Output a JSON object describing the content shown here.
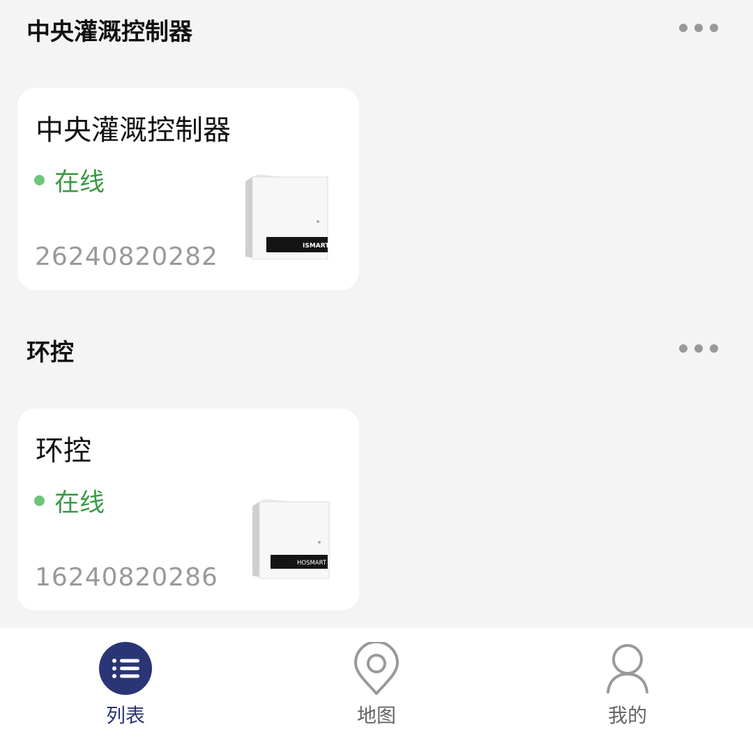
{
  "groups": [
    {
      "title": "中央灌溉控制器",
      "device": {
        "name": "中央灌溉控制器",
        "status": "在线",
        "serial": "26240820282",
        "brand": "ISMART"
      }
    },
    {
      "title": "环控",
      "device": {
        "name": "环控",
        "status": "在线",
        "serial": "16240820286",
        "brand": "HOSMART"
      }
    }
  ],
  "nav": {
    "items": [
      {
        "label": "列表",
        "icon": "list-icon",
        "active": true
      },
      {
        "label": "地图",
        "icon": "map-pin-icon",
        "active": false
      },
      {
        "label": "我的",
        "icon": "user-icon",
        "active": false
      }
    ]
  },
  "colors": {
    "accent": "#2a3575",
    "online": "#3a9a44",
    "online_dot": "#6dc57a"
  }
}
